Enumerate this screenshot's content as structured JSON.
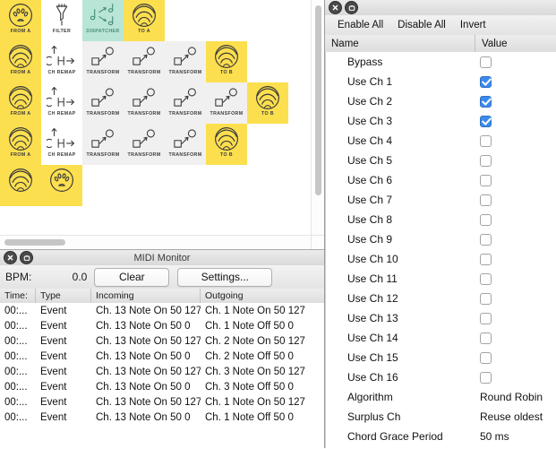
{
  "graph_window": {
    "title": "",
    "close_icon": "close-icon",
    "minimize_icon": "window-restore-icon",
    "rows": [
      {
        "cells": [
          {
            "label": "FROM A",
            "icon": "midi-din-icon",
            "style": "y"
          },
          {
            "label": "FILTER",
            "icon": "funnel-icon",
            "style": "w"
          },
          {
            "label": "DISPATCHER",
            "icon": "dispatcher-notes-icon",
            "style": "t"
          },
          {
            "label": "TO A",
            "icon": "radio-waves-icon",
            "style": "y"
          }
        ]
      },
      {
        "cells": [
          {
            "label": "FROM A",
            "icon": "radio-waves-icon",
            "style": "y"
          },
          {
            "label": "CH REMAP",
            "icon": "ch-remap-icon",
            "style": "w"
          },
          {
            "label": "TRANSFORM",
            "icon": "transform-icon",
            "style": "g"
          },
          {
            "label": "TRANSFORM",
            "icon": "transform-icon",
            "style": "g"
          },
          {
            "label": "TRANSFORM",
            "icon": "transform-icon",
            "style": "g"
          },
          {
            "label": "TO B",
            "icon": "radio-waves-icon",
            "style": "y"
          }
        ]
      },
      {
        "cells": [
          {
            "label": "FROM A",
            "icon": "radio-waves-icon",
            "style": "y"
          },
          {
            "label": "CH REMAP",
            "icon": "ch-remap-icon",
            "style": "w"
          },
          {
            "label": "TRANSFORM",
            "icon": "transform-icon",
            "style": "g"
          },
          {
            "label": "TRANSFORM",
            "icon": "transform-icon",
            "style": "g"
          },
          {
            "label": "TRANSFORM",
            "icon": "transform-icon",
            "style": "g"
          },
          {
            "label": "TRANSFORM",
            "icon": "transform-icon",
            "style": "g"
          },
          {
            "label": "TO B",
            "icon": "radio-waves-icon",
            "style": "y"
          }
        ]
      },
      {
        "cells": [
          {
            "label": "FROM A",
            "icon": "radio-waves-icon",
            "style": "y"
          },
          {
            "label": "CH REMAP",
            "icon": "ch-remap-icon",
            "style": "w"
          },
          {
            "label": "TRANSFORM",
            "icon": "transform-icon",
            "style": "g"
          },
          {
            "label": "TRANSFORM",
            "icon": "transform-icon",
            "style": "g"
          },
          {
            "label": "TRANSFORM",
            "icon": "transform-icon",
            "style": "g"
          },
          {
            "label": "TO B",
            "icon": "radio-waves-icon",
            "style": "y"
          }
        ]
      },
      {
        "cells": [
          {
            "label": "",
            "icon": "radio-waves-icon",
            "style": "y"
          },
          {
            "label": "",
            "icon": "midi-din-icon",
            "style": "y"
          }
        ]
      }
    ]
  },
  "midi_monitor": {
    "title": "MIDI Monitor",
    "close_icon": "close-icon",
    "minimize_icon": "window-restore-icon",
    "bpm_label": "BPM:",
    "bpm_value": "0.0",
    "clear_label": "Clear",
    "settings_label": "Settings...",
    "columns": [
      "Time:",
      "Type",
      "Incoming",
      "Outgoing"
    ],
    "rows": [
      {
        "time": "00:...",
        "type": "Event",
        "incoming": "Ch. 13 Note On 50 127",
        "outgoing": "Ch. 1 Note On 50 127"
      },
      {
        "time": "00:...",
        "type": "Event",
        "incoming": "Ch. 13 Note On 50 0",
        "outgoing": "Ch. 1 Note Off 50 0"
      },
      {
        "time": "00:...",
        "type": "Event",
        "incoming": "Ch. 13 Note On 50 127",
        "outgoing": "Ch. 2 Note On 50 127"
      },
      {
        "time": "00:...",
        "type": "Event",
        "incoming": "Ch. 13 Note On 50 0",
        "outgoing": "Ch. 2 Note Off 50 0"
      },
      {
        "time": "00:...",
        "type": "Event",
        "incoming": "Ch. 13 Note On 50 127",
        "outgoing": "Ch. 3 Note On 50 127"
      },
      {
        "time": "00:...",
        "type": "Event",
        "incoming": "Ch. 13 Note On 50 0",
        "outgoing": "Ch. 3 Note Off 50 0"
      },
      {
        "time": "00:...",
        "type": "Event",
        "incoming": "Ch. 13 Note On 50 127",
        "outgoing": "Ch. 1 Note On 50 127"
      },
      {
        "time": "00:...",
        "type": "Event",
        "incoming": "Ch. 13 Note On 50 0",
        "outgoing": "Ch. 1 Note Off 50 0"
      }
    ]
  },
  "inspector": {
    "title": "",
    "close_icon": "close-icon",
    "minimize_icon": "window-restore-icon",
    "toolbar": [
      "Enable All",
      "Disable All",
      "Invert"
    ],
    "columns": [
      "Name",
      "Value"
    ],
    "params": [
      {
        "name": "Bypass",
        "kind": "checkbox",
        "checked": false
      },
      {
        "name": "Use Ch 1",
        "kind": "checkbox",
        "checked": true
      },
      {
        "name": "Use Ch 2",
        "kind": "checkbox",
        "checked": true
      },
      {
        "name": "Use Ch 3",
        "kind": "checkbox",
        "checked": true
      },
      {
        "name": "Use Ch 4",
        "kind": "checkbox",
        "checked": false
      },
      {
        "name": "Use Ch 5",
        "kind": "checkbox",
        "checked": false
      },
      {
        "name": "Use Ch 6",
        "kind": "checkbox",
        "checked": false
      },
      {
        "name": "Use Ch 7",
        "kind": "checkbox",
        "checked": false
      },
      {
        "name": "Use Ch 8",
        "kind": "checkbox",
        "checked": false
      },
      {
        "name": "Use Ch 9",
        "kind": "checkbox",
        "checked": false
      },
      {
        "name": "Use Ch 10",
        "kind": "checkbox",
        "checked": false
      },
      {
        "name": "Use Ch 11",
        "kind": "checkbox",
        "checked": false
      },
      {
        "name": "Use Ch 12",
        "kind": "checkbox",
        "checked": false
      },
      {
        "name": "Use Ch 13",
        "kind": "checkbox",
        "checked": false
      },
      {
        "name": "Use Ch 14",
        "kind": "checkbox",
        "checked": false
      },
      {
        "name": "Use Ch 15",
        "kind": "checkbox",
        "checked": false
      },
      {
        "name": "Use Ch 16",
        "kind": "checkbox",
        "checked": false
      },
      {
        "name": "Algorithm",
        "kind": "text",
        "value": "Round Robin"
      },
      {
        "name": "Surplus Ch",
        "kind": "text",
        "value": "Reuse oldest"
      },
      {
        "name": "Chord Grace Period",
        "kind": "text",
        "value": "50 ms"
      }
    ]
  },
  "colors": {
    "node_yellow": "#fcdf4f",
    "node_selected_teal": "#b9e5d6",
    "node_gray": "#f0f0f0",
    "checkbox_blue": "#3b8aec",
    "chrome_gray": "#ececec"
  }
}
